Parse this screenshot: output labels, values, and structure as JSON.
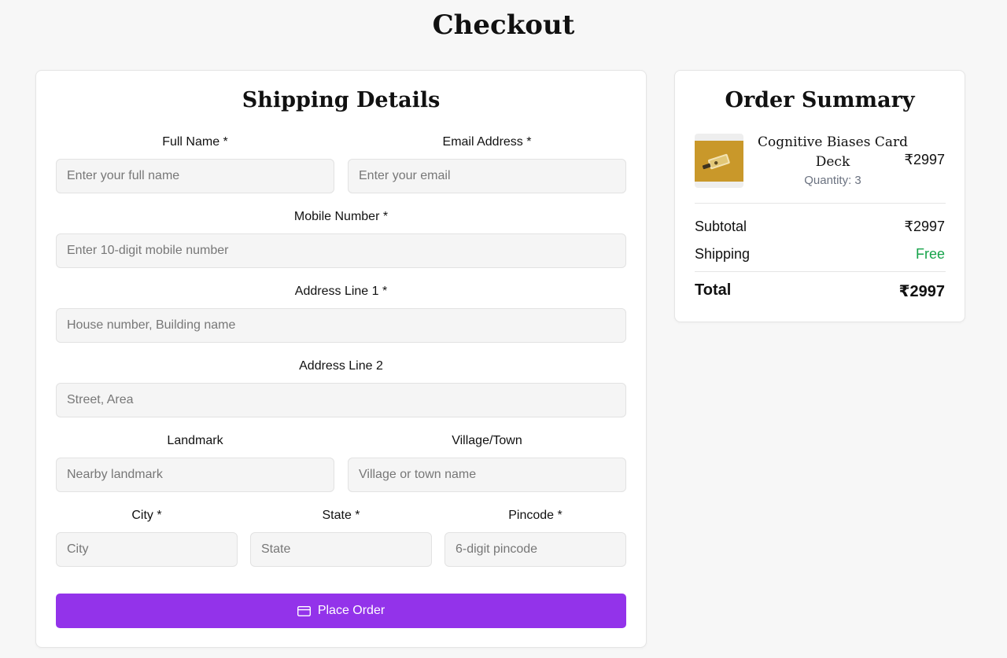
{
  "page": {
    "title": "Checkout"
  },
  "shipping": {
    "title": "Shipping Details",
    "fields": {
      "full_name": {
        "label": "Full Name *",
        "placeholder": "Enter your full name",
        "value": ""
      },
      "email": {
        "label": "Email Address *",
        "placeholder": "Enter your email",
        "value": ""
      },
      "mobile": {
        "label": "Mobile Number *",
        "placeholder": "Enter 10-digit mobile number",
        "value": ""
      },
      "address1": {
        "label": "Address Line 1 *",
        "placeholder": "House number, Building name",
        "value": ""
      },
      "address2": {
        "label": "Address Line 2",
        "placeholder": "Street, Area",
        "value": ""
      },
      "landmark": {
        "label": "Landmark",
        "placeholder": "Nearby landmark",
        "value": ""
      },
      "village": {
        "label": "Village/Town",
        "placeholder": "Village or town name",
        "value": ""
      },
      "city": {
        "label": "City *",
        "placeholder": "City",
        "value": ""
      },
      "state": {
        "label": "State *",
        "placeholder": "State",
        "value": ""
      },
      "pincode": {
        "label": "Pincode *",
        "placeholder": "6-digit pincode",
        "value": ""
      }
    },
    "submit": {
      "label": "Place Order",
      "icon": "credit-card-icon"
    }
  },
  "summary": {
    "title": "Order Summary",
    "item": {
      "name": "Cognitive Biases Card Deck",
      "quantity": "Quantity: 3",
      "price": "₹2997",
      "image": "product-thumbnail"
    },
    "subtotal": {
      "label": "Subtotal",
      "value": "₹2997"
    },
    "shipping": {
      "label": "Shipping",
      "value": "Free"
    },
    "total": {
      "label": "Total",
      "value": "₹2997"
    }
  },
  "colors": {
    "accent": "#9333ea",
    "free": "#16a34a",
    "background": "#f7f7f7"
  }
}
